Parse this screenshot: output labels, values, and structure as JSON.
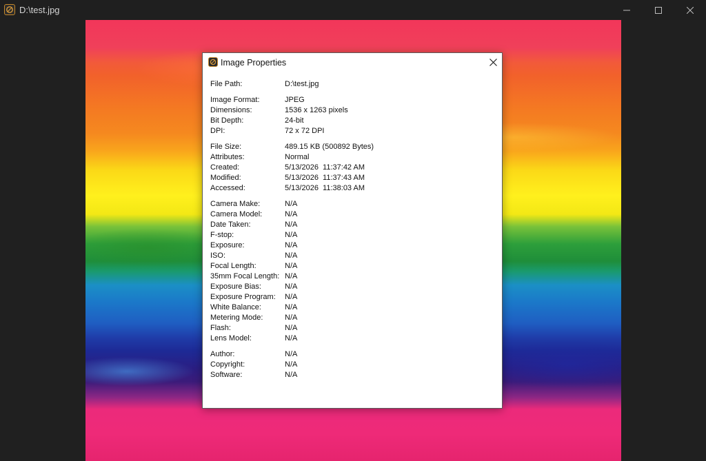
{
  "window": {
    "title": "D:\\test.jpg",
    "icon": "app-icon",
    "controls": [
      "minimize-icon",
      "maximize-icon",
      "close-icon"
    ]
  },
  "dialog": {
    "title": "Image Properties",
    "groups": [
      [
        {
          "key": "File Path:",
          "value": "D:\\test.jpg"
        }
      ],
      [
        {
          "key": "Image Format:",
          "value": "JPEG"
        },
        {
          "key": "Dimensions:",
          "value": "1536 x 1263 pixels"
        },
        {
          "key": "Bit Depth:",
          "value": "24-bit"
        },
        {
          "key": "DPI:",
          "value": "72 x 72 DPI"
        }
      ],
      [
        {
          "key": "File Size:",
          "value": "489.15 KB (500892 Bytes)"
        },
        {
          "key": "Attributes:",
          "value": "Normal"
        },
        {
          "key": "Created:",
          "value": "5/13/2026  11:37:42 AM"
        },
        {
          "key": "Modified:",
          "value": "5/13/2026  11:37:43 AM"
        },
        {
          "key": "Accessed:",
          "value": "5/13/2026  11:38:03 AM"
        }
      ],
      [
        {
          "key": "Camera Make:",
          "value": "N/A"
        },
        {
          "key": "Camera Model:",
          "value": "N/A"
        },
        {
          "key": "Date Taken:",
          "value": "N/A"
        },
        {
          "key": "F-stop:",
          "value": "N/A"
        },
        {
          "key": "Exposure:",
          "value": "N/A"
        },
        {
          "key": "ISO:",
          "value": "N/A"
        },
        {
          "key": "Focal Length:",
          "value": "N/A"
        },
        {
          "key": "35mm Focal Length:",
          "value": "N/A"
        },
        {
          "key": "Exposure Bias:",
          "value": "N/A"
        },
        {
          "key": "Exposure Program:",
          "value": "N/A"
        },
        {
          "key": "White Balance:",
          "value": "N/A"
        },
        {
          "key": "Metering Mode:",
          "value": "N/A"
        },
        {
          "key": "Flash:",
          "value": "N/A"
        },
        {
          "key": "Lens Model:",
          "value": "N/A"
        }
      ],
      [
        {
          "key": "Author:",
          "value": "N/A"
        },
        {
          "key": "Copyright:",
          "value": "N/A"
        },
        {
          "key": "Software:",
          "value": "N/A"
        }
      ]
    ]
  },
  "colors": {
    "titlebar": "#1f1f1f",
    "viewer_background": "#202020",
    "dialog_background": "#ffffff",
    "icon_accent": "#c8892a"
  }
}
